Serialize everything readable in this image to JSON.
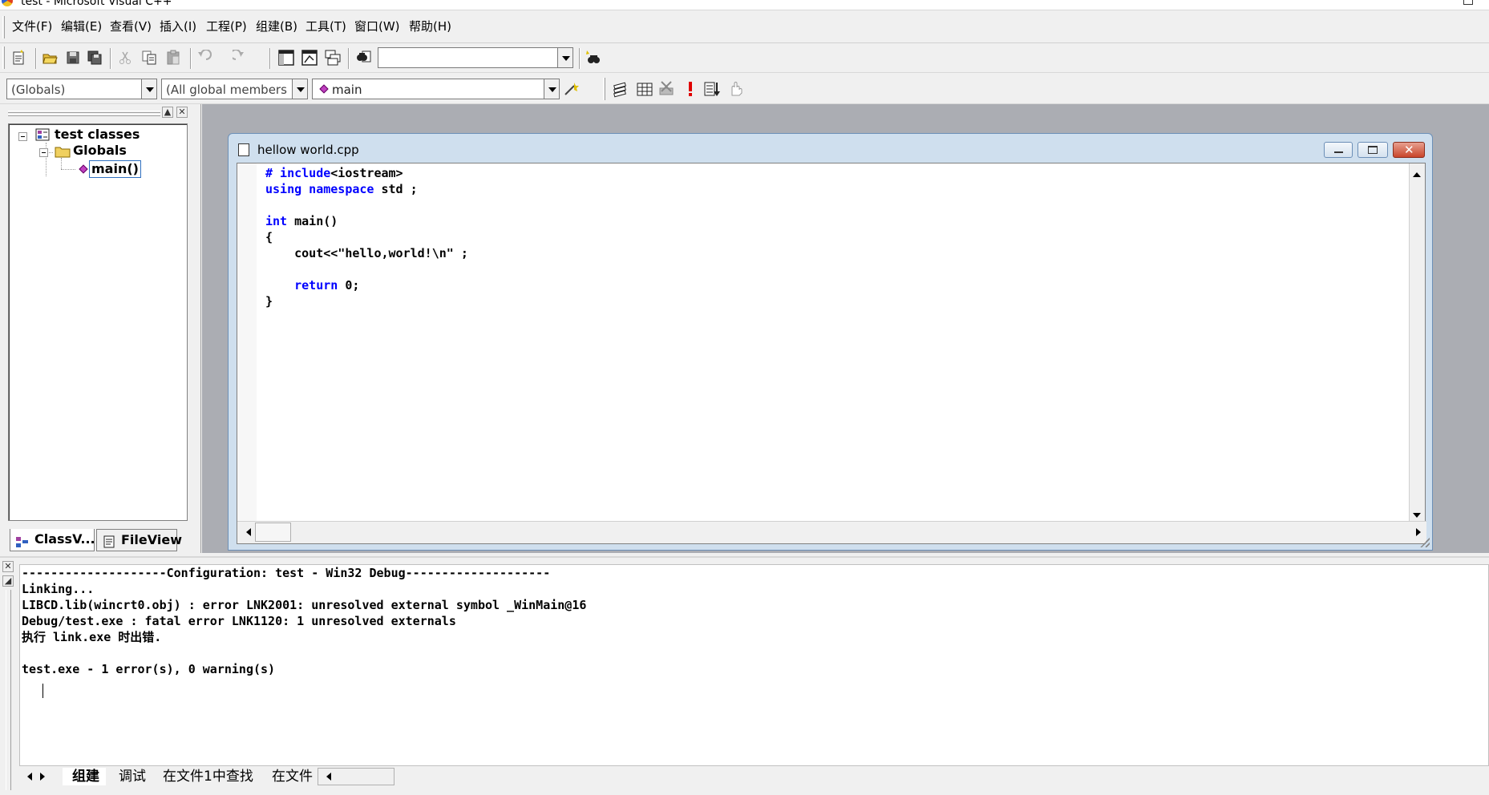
{
  "window": {
    "title": "test - Microsoft Visual C++"
  },
  "menu": {
    "items": [
      "文件(F)",
      "编辑(E)",
      "查看(V)",
      "插入(I)",
      "工程(P)",
      "组建(B)",
      "工具(T)",
      "窗口(W)",
      "帮助(H)"
    ]
  },
  "toolbar1": {
    "icons": [
      "new-text-file-icon",
      "open-icon",
      "save-icon",
      "save-all-icon",
      "cut-icon",
      "copy-icon",
      "paste-icon",
      "undo-icon",
      "redo-icon",
      "workspace-icon",
      "output-icon",
      "window-list-icon",
      "find-in-files-icon",
      "find-icon"
    ],
    "find_combo_value": ""
  },
  "toolbar2": {
    "scope_combo": "(Globals)",
    "members_combo": "(All global members",
    "function_combo": "main",
    "icons": [
      "wizard-bar-actions-icon",
      "compile-icon",
      "build-icon",
      "stop-build-icon",
      "execute-icon",
      "go-icon",
      "insert-breakpoint-icon"
    ]
  },
  "workspace": {
    "tree": {
      "root": "test classes",
      "folder": "Globals",
      "leaf": "main()"
    },
    "tabs": [
      "ClassV...",
      "FileView"
    ]
  },
  "editor": {
    "title": "hellow world.cpp",
    "code_lines": [
      [
        {
          "t": "# include",
          "k": true
        },
        {
          "t": "<iostream>",
          "k": false
        }
      ],
      [
        {
          "t": "using namespace",
          "k": true
        },
        {
          "t": " std ;",
          "k": false
        }
      ],
      [],
      [
        {
          "t": "int",
          "k": true
        },
        {
          "t": " main()",
          "k": false
        }
      ],
      [
        {
          "t": "{",
          "k": false
        }
      ],
      [
        {
          "t": "    cout<<\"hello,world!\\n\" ;",
          "k": false
        }
      ],
      [],
      [
        {
          "t": "    ",
          "k": false
        },
        {
          "t": "return",
          "k": true
        },
        {
          "t": " 0;",
          "k": false
        }
      ],
      [
        {
          "t": "}",
          "k": false
        }
      ]
    ]
  },
  "output": {
    "lines": [
      "--------------------Configuration: test - Win32 Debug--------------------",
      "Linking...",
      "LIBCD.lib(wincrt0.obj) : error LNK2001: unresolved external symbol _WinMain@16",
      "Debug/test.exe : fatal error LNK1120: 1 unresolved externals",
      "执行 link.exe 时出错.",
      "",
      "test.exe - 1 error(s), 0 warning(s)"
    ],
    "tabs": [
      "组建",
      "调试",
      "在文件1中查找",
      "在文件"
    ]
  },
  "colors": {
    "keyword": "#0000ff",
    "mdi_background": "#abadb3",
    "window_frame": "#cfdfee"
  }
}
